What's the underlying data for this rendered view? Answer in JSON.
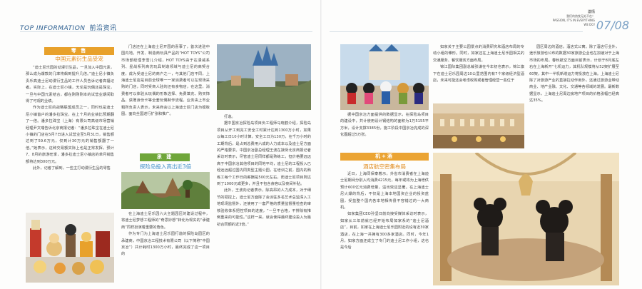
{
  "header": {
    "section_en": "TOP INFORMATION",
    "section_cn": "前沿资讯",
    "tagline_cn": "激情",
    "tagline_cn2": "我们的热忱无处不在！",
    "tagline_en1": "PASSION, IT'S IN EVERYTHING",
    "tagline_en2": "WE DO!",
    "page_numbers": "07/08"
  },
  "col1": {
    "bar_label": "零 售",
    "title": "中国元素衍生品受宠",
    "paragraphs": [
      "“迪士尼乐园的动漫衍生品，一旦加入中国元素，那么成为爆款的几率将飙到提升几倍。”迪士尼小镇负责乐高迪士尼动漫衍生品的工作人员告诉记者高福记者。实际上，在迪士尼小镇，无论是玩偶还是珠宝，一旦与中国元素结合，都在刚刚刚本的试营业期间取得了可观的业绩。",
      "作为迪士尼的战略联盟成员之一，同时也是迪士尼小镇首户的潘多拉珠宝，在上个月的业绩比预期翻了一倍。潘多拉珠宝（上海）有限公司高级市场营销经理尹文瑞告诉北京商报记者：“潘多拉珠宝在迪士尼小镇的门店在5月7日进入试营业至5月31日，销售额达到了59.6万元，仅到计30万元的销售额翻了一倍。”她表示，这种交易额实际上也是正常发挥，预计7、8月的旅游旺季，潘多拉迪士尼小镇店的单月销售额将达到300万元。",
      "此外，记者了解到，一些主打动漫衍生品的零售"
    ]
  },
  "col2": {
    "paragraphs_top": [
      "门店还在上海迪士尼开园的喜事了，首次进驻中国内地。开发、制造商玩具产品的“HOT TOYS”公司市场部经理李雪儿介绍，HOT TOYS由于在漫威系列、星战系列高仿玩具制造领域与迪士尼的高契合度，成为受迪士尼的商户之一，与其他门店不同，上海迪士尼店是目前全球唯一一家消费者可以在现场采购的门店，同时受商人驻的还有食物店，在这里，消费者可以体验从玩偶的形象选择、免费填充、购买饰品、获赠身份卡等全套玩偶制作流程。业务由上市业粗所负责人表示，未来商会以上海迪士尼门店为模板图，面向全国进行扩张和推广。"
    ],
    "bar_label": "承 建",
    "title": "探险岛投入高出近3倍",
    "paragraphs_bottom": [
      "在上海迪士尼乐园六大主题园区的建设过程中，将迪士尼梦想工程师的“奇思妙想”转化为现实的“承建商”同样扮演着重要的角色。",
      "作为专门为上海迪士尼乐园打造的探险岛园区的承建商，中国京冶工程技术有限公司（以下简称“中国京冶”）共计耗时1300万小时，最终完成了这一项目的"
    ]
  },
  "col3": {
    "paragraphs_top": [
      "打造。",
      "据中国京冶探险岛项目负工程师马晓鹤介绍，探险岛项目从开工到完工安全工时累计达到1300万小时，如果以每工日10小时计算，安全工日为130万，在千万小时的工期背后，是占到总费用六成的人力成本以及迪士尼方面的严格要求。中国京冶副总经理王波在接受北京商报记者采访时表示，尽管迪士尼同样都是熟练工，但价格要远远高于中国京冶其他项目的同地平均，迪士尼的工程投入已经远远超过国内同类型主题公园，在培训之前，国内的熟练工每个工作日的薪酬是500元左右，而迪士尼项目则达到了1000元或更多，并且不包含食宿以及夜间补贴。",
      "此外，王波向记者表示，除高昂的人力成本，对于细节的把控上，迪士尼方面除了会派驻多名艺术总监深入工地现场监督外，还使用了一套严格的质量监督量检查的审核验收体系把控项目的进度，“一旦不合格，不排除有推倒重来的可能性。”这样一来，就会使得最终建设投入为最初合同额的近3倍。”"
    ]
  },
  "col4": {
    "caption": "据中国京冶方面提供的数据显示，在探险岛项目的建设中，共计使用设计钢结构的面积为1万5155平方米，设计支撑3385份，施工阶段中国京冶完成的深化图超过5万张。",
    "bar_label": "机+酒",
    "title": "酒店航空密集布局",
    "paragraphs": [
      "近日，上海同保泰着示，外省市消费者在上海迪士尼期间分别入均消费4215元，每年或将为上海增供预计600亿元消费增量，溢出效应显著。在上海迪士尼火爆的背后，不仅是上海本地国资企业的投资蓝图，受益整个国内各本地相传县不容错过的一大商机。",
      "如家集团CEO孙坚日前向接受媒体采访时表示，如家从三年前就已经开始布局如家系的“迪士尼酒店”，目前，如家在上海迪士尼乐园附近的设有近30家酒店，在上海一共拥有300多家酒店。同时，今年1月，如家方面还成立了专门的迪士尼工作小组，这也是今后"
    ]
  },
  "col5": {
    "paragraphs": [
      "如家关于主要公园景点的消费研究和酒店布局的专动小组的雏形。同时，如家还在上海迪士尼乐园相关的交通服务、餐饮服务方面布局。",
      "锦江国际集团副总裁张谦在今年初也表示，锦江旗下在迪士尼乐园周边10公里范围内有7个家级经济型酒店，未来可能还会考虑收购或者管理经营一些位于"
    ]
  },
  "col6": {
    "paragraphs": [
      "园区周边的酒店。酒店式公寓。除了酒店行业外，途乐旅游也公布的数据30家旅游企业也在加速对于上海市场的布局。春秋航空方面目前表示，计划于8月底左右在上海新开“七机运力，其机队规模将从52架扩展至60架，其中一半机新增运力将投放在上海。上海迪士尼除了对旅游产业的直接拉动作用外，还通过旅游业带动商业、地产业融、文化、交通等各领域的发展。最新数据显示，上海迪士尼周边房地产项目的价格涨幅已经高达35%。"
    ]
  },
  "images": {
    "castle": "迪士尼城堡鸟瞰图",
    "store_toys": "迪士尼商店玩偶",
    "crafts": "工艺品陈列",
    "adventure_isle": "探险岛园区",
    "characters": "迪士尼人物在城堡前",
    "hotel_exterior": "迪士尼酒店外观",
    "hotel_lobby": "酒店大堂雕塑"
  },
  "colors": {
    "orange": "#e8a12b",
    "green": "#6fa63a",
    "blue_title": "#3d8dc8",
    "header_blue": "#2a5d8f"
  }
}
